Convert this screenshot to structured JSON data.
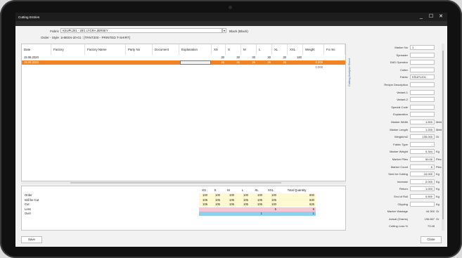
{
  "window": {
    "title": "Cutting Entries",
    "minimize": "_",
    "maximize": "☐",
    "close": "✕"
  },
  "header": {
    "fabric_label": "Fabric",
    "fabric_value": "KSUPL201 - 20/1 LYCRA JERSEY",
    "color_value": "Black (Black)",
    "order_label": "Order - Style",
    "order_value": "1H8004-20-01 : [TRNT200 - PRINTED T-SHIRT]"
  },
  "grid": {
    "columns": [
      "Date",
      "Factory",
      "Factory Name",
      "Party No",
      "Document",
      "Explanation",
      "XS",
      "S",
      "M",
      "L",
      "XL",
      "XXL",
      "Weight",
      "Fo rmi"
    ],
    "rows": [
      {
        "date": "15.08.2020",
        "xs": "30",
        "s": "30",
        "m": "30",
        "l": "30",
        "xl": "30",
        "xxl": "180",
        "weight": ""
      },
      {
        "date": "15.08.2020",
        "xs": "35",
        "s": "35",
        "m": "35",
        "l": "35",
        "xl": "35",
        "xxl": "",
        "weight": "0.000"
      },
      {
        "date": "",
        "xs": "",
        "s": "",
        "m": "",
        "l": "",
        "xl": "",
        "xxl": "",
        "weight": "0.000"
      }
    ]
  },
  "side_tab": "Cutting Analysis Sheet",
  "right_panel": [
    {
      "label": "Marker No",
      "value": "1",
      "unit": ""
    },
    {
      "label": "Spreader",
      "value": "",
      "unit": ""
    },
    {
      "label": "DAD Operator",
      "value": "",
      "unit": ""
    },
    {
      "label": "Cutter",
      "value": "",
      "unit": ""
    },
    {
      "label": "Fabric",
      "value": "KSUPL201",
      "unit": ""
    },
    {
      "label": "Recipe Description",
      "value": "",
      "unit": ""
    },
    {
      "label": "Variant-1",
      "value": "",
      "unit": ""
    },
    {
      "label": "Variant-2",
      "value": "",
      "unit": ""
    },
    {
      "label": "Special Code",
      "value": "",
      "unit": ""
    },
    {
      "label": "Explanation",
      "value": "",
      "unit": ""
    },
    {
      "label": "Marker Width",
      "value": "1.500",
      "unit": "Meter"
    },
    {
      "label": "Marker Length",
      "value": "1.200",
      "unit": "Meter"
    },
    {
      "label": "Weight/m2",
      "value": "135.000",
      "unit": "Gr"
    },
    {
      "label": "Fabric Type",
      "value": "-",
      "unit": ""
    },
    {
      "label": "Marker Weight",
      "value": "0.344",
      "unit": "Kg"
    },
    {
      "label": "Marker Plies",
      "value": "50.00",
      "unit": "Piece"
    },
    {
      "label": "Marker Count",
      "value": "6",
      "unit": "Piece"
    },
    {
      "label": "Sent for Cutting",
      "value": "10.000",
      "unit": "Kg"
    },
    {
      "label": "Increase",
      "value": "2.000",
      "unit": "Kg"
    },
    {
      "label": "Return",
      "value": "1.000",
      "unit": "Kg"
    },
    {
      "label": "End of Roll",
      "value": "0.500",
      "unit": "Kg"
    },
    {
      "label": "Clipping",
      "value": "",
      "unit": "Kg"
    },
    {
      "label": "Marker Wastage",
      "value": "44.300",
      "unit": "Gr"
    },
    {
      "label": "Actual (Grams)",
      "value": "196.667",
      "unit": "Gr"
    },
    {
      "label": "Cutting Loss %",
      "value": "73.48",
      "unit": ""
    }
  ],
  "summary": {
    "columns": [
      "XS",
      "S",
      "M",
      "L",
      "XL",
      "XXL",
      "Total Quantity"
    ],
    "rows": [
      {
        "label": "Order",
        "vals": [
          "100",
          "100",
          "100",
          "100",
          "100",
          "100"
        ],
        "total": "600"
      },
      {
        "label": "Will be Cut",
        "vals": [
          "105",
          "105",
          "105",
          "105",
          "105",
          "105"
        ],
        "total": "630"
      },
      {
        "label": "Cut",
        "vals": [
          "105",
          "105",
          "105",
          "105",
          "105",
          "100"
        ],
        "total": "626"
      },
      {
        "label": "Less",
        "vals": [
          "",
          "",
          "",
          "",
          "",
          "5"
        ],
        "total": "5"
      },
      {
        "label": "Over",
        "vals": [
          "",
          "",
          "",
          "",
          "1",
          ""
        ],
        "total": "1"
      }
    ]
  },
  "buttons": {
    "save": "Save",
    "close": "Close"
  },
  "colors": {
    "accent": "#f58220",
    "pink": "#f7c6d0",
    "blue": "#8fd0ee",
    "yellow": "#fff8d0"
  }
}
